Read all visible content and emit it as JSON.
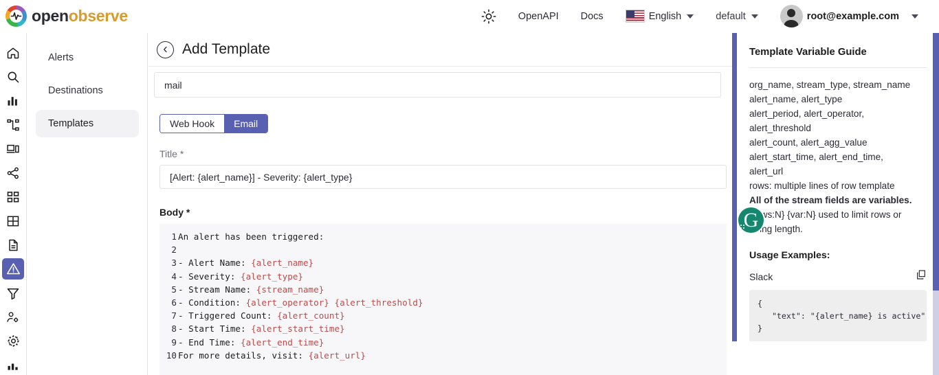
{
  "app": {
    "logo_part1": "open",
    "logo_part2": "observe",
    "accent_color": "#5960b2"
  },
  "topbar": {
    "theme_toggle_icon": "sun-icon",
    "openapi_label": "OpenAPI",
    "docs_label": "Docs",
    "language_label": "English",
    "org_label": "default",
    "user_email": "root@example.com"
  },
  "rail": {
    "items": [
      {
        "icon": "home-icon",
        "active": false
      },
      {
        "icon": "search-icon",
        "active": false
      },
      {
        "icon": "bar-chart-icon",
        "active": false
      },
      {
        "icon": "pipelines-icon",
        "active": false
      },
      {
        "icon": "rum-devices-icon",
        "active": false
      },
      {
        "icon": "traces-share-icon",
        "active": false
      },
      {
        "icon": "dashboards-grid-icon",
        "active": false
      },
      {
        "icon": "streams-table-icon",
        "active": false
      },
      {
        "icon": "logs-document-icon",
        "active": false
      },
      {
        "icon": "alerts-warning-icon",
        "active": true
      },
      {
        "icon": "functions-filter-icon",
        "active": false
      },
      {
        "icon": "users-settings-icon",
        "active": false
      },
      {
        "icon": "gear-settings-icon",
        "active": false
      },
      {
        "icon": "usage-chart-icon",
        "active": false
      }
    ]
  },
  "subnav": {
    "items": [
      {
        "label": "Alerts",
        "active": false
      },
      {
        "label": "Destinations",
        "active": false
      },
      {
        "label": "Templates",
        "active": true
      }
    ]
  },
  "page": {
    "back_icon": "chevron-left-circle-icon",
    "title": "Add Template"
  },
  "form": {
    "name_value": "mail",
    "type_toggle": {
      "webhook_label": "Web Hook",
      "email_label": "Email",
      "selected": "Email"
    },
    "title_label": "Title *",
    "title_value": "[Alert: {alert_name}] - Severity: {alert_type}",
    "body_label": "Body *",
    "body_lines": [
      {
        "n": "1",
        "parts": [
          {
            "t": "An alert has been triggered:",
            "v": false
          }
        ]
      },
      {
        "n": "2",
        "parts": [
          {
            "t": "",
            "v": false
          }
        ]
      },
      {
        "n": "3",
        "parts": [
          {
            "t": "- Alert Name: ",
            "v": false
          },
          {
            "t": "{alert_name}",
            "v": true
          }
        ]
      },
      {
        "n": "4",
        "parts": [
          {
            "t": "- Severity: ",
            "v": false
          },
          {
            "t": "{alert_type}",
            "v": true
          }
        ]
      },
      {
        "n": "5",
        "parts": [
          {
            "t": "- Stream Name: ",
            "v": false
          },
          {
            "t": "{stream_name}",
            "v": true
          }
        ]
      },
      {
        "n": "6",
        "parts": [
          {
            "t": "- Condition: ",
            "v": false
          },
          {
            "t": "{alert_operator}",
            "v": true
          },
          {
            "t": " ",
            "v": false
          },
          {
            "t": "{alert_threshold}",
            "v": true
          }
        ]
      },
      {
        "n": "7",
        "parts": [
          {
            "t": "- Triggered Count: ",
            "v": false
          },
          {
            "t": "{alert_count}",
            "v": true
          }
        ]
      },
      {
        "n": "8",
        "parts": [
          {
            "t": "- Start Time: ",
            "v": false
          },
          {
            "t": "{alert_start_time}",
            "v": true
          }
        ]
      },
      {
        "n": "9",
        "parts": [
          {
            "t": "- End Time: ",
            "v": false
          },
          {
            "t": "{alert_end_time}",
            "v": true
          }
        ]
      },
      {
        "n": "10",
        "parts": [
          {
            "t": "For more details, visit: ",
            "v": false
          },
          {
            "t": "{alert_url}",
            "v": true
          }
        ]
      }
    ]
  },
  "guide": {
    "heading": "Template Variable Guide",
    "lines": [
      {
        "text": "org_name, stream_type, stream_name",
        "bold": false
      },
      {
        "text": "alert_name, alert_type",
        "bold": false
      },
      {
        "text": "alert_period, alert_operator,",
        "bold": false
      },
      {
        "text": "alert_threshold",
        "bold": false
      },
      {
        "text": "alert_count, alert_agg_value",
        "bold": false
      },
      {
        "text": "alert_start_time, alert_end_time,",
        "bold": false
      },
      {
        "text": "alert_url",
        "bold": false
      },
      {
        "text": "rows: multiple lines of row template",
        "bold": false
      },
      {
        "text": "All of the stream fields are variables.",
        "bold": true
      },
      {
        "text": "{rows:N} {var:N} used to limit rows or",
        "bold": false
      },
      {
        "text": "string length.",
        "bold": false
      }
    ],
    "usage_title": "Usage Examples:",
    "slack_label": "Slack",
    "copy_icon": "copy-icon",
    "slack_code": "{\n   \"text\": \"{alert_name} is active\"\n}"
  },
  "overlay": {
    "grammarly_icon": "grammarly-icon",
    "grammarly_letter": "G"
  }
}
